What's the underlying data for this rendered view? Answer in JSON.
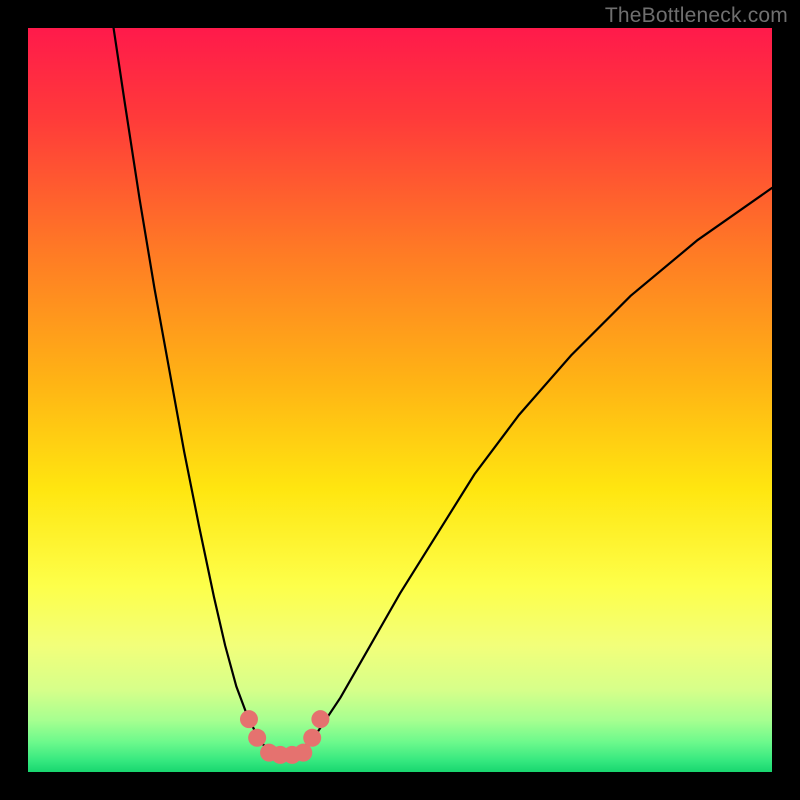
{
  "watermark": "TheBottleneck.com",
  "gradient": {
    "stops": [
      {
        "offset": 0.0,
        "color": "#ff1a4b"
      },
      {
        "offset": 0.12,
        "color": "#ff3a3a"
      },
      {
        "offset": 0.3,
        "color": "#ff7a25"
      },
      {
        "offset": 0.48,
        "color": "#ffb514"
      },
      {
        "offset": 0.62,
        "color": "#ffe610"
      },
      {
        "offset": 0.75,
        "color": "#fdff4a"
      },
      {
        "offset": 0.83,
        "color": "#f2ff7a"
      },
      {
        "offset": 0.89,
        "color": "#d6ff8a"
      },
      {
        "offset": 0.93,
        "color": "#a7ff90"
      },
      {
        "offset": 0.96,
        "color": "#6cf98c"
      },
      {
        "offset": 0.985,
        "color": "#35e87f"
      },
      {
        "offset": 1.0,
        "color": "#18d66f"
      }
    ]
  },
  "marker": {
    "color": "#e5726f",
    "stroke": "#cc5a57"
  },
  "chart_data": {
    "type": "line",
    "title": "",
    "xlabel": "",
    "ylabel": "",
    "xlim": [
      0,
      100
    ],
    "ylim": [
      0,
      100
    ],
    "grid": false,
    "note": "Values are estimated from pixel positions; no numeric axis labels are present in the image.",
    "series": [
      {
        "name": "left-curve",
        "x": [
          11.5,
          13,
          15,
          17,
          19,
          21,
          23,
          25,
          26.5,
          28,
          29.5,
          31,
          32
        ],
        "y": [
          100,
          90,
          77,
          65,
          54,
          43,
          33,
          23.5,
          17,
          11.5,
          7.5,
          4.5,
          3.2
        ]
      },
      {
        "name": "right-curve",
        "x": [
          37,
          39,
          42,
          46,
          50,
          55,
          60,
          66,
          73,
          81,
          90,
          100
        ],
        "y": [
          3.2,
          5.5,
          10,
          17,
          24,
          32,
          40,
          48,
          56,
          64,
          71.5,
          78.5
        ]
      },
      {
        "name": "valley-highlight",
        "x": [
          29.7,
          30.8,
          32.4,
          33.9,
          35.5,
          37.0,
          38.2,
          39.3
        ],
        "y": [
          7.1,
          4.6,
          2.6,
          2.3,
          2.3,
          2.6,
          4.6,
          7.1
        ]
      }
    ]
  }
}
